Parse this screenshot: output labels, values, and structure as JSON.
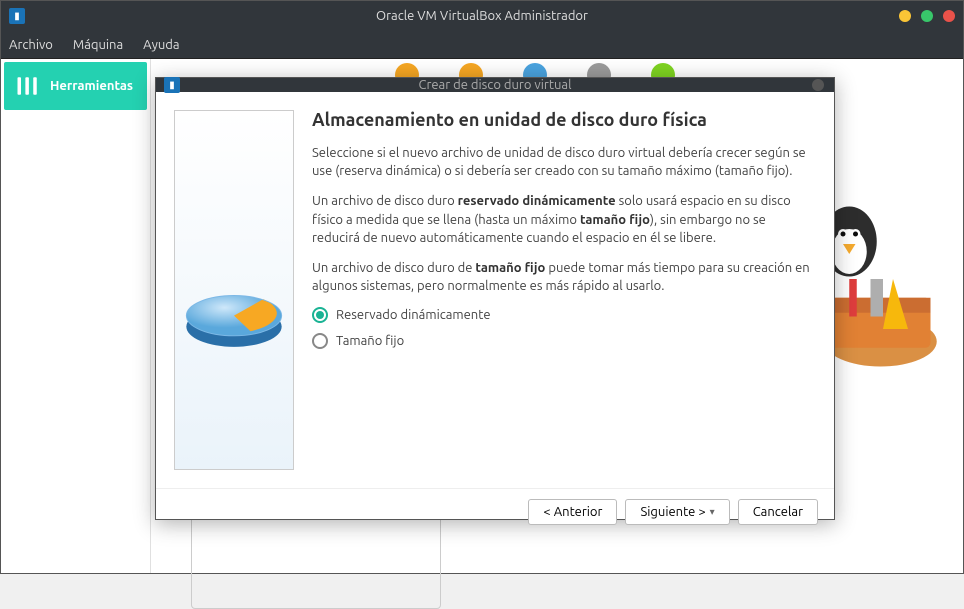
{
  "window": {
    "title": "Oracle VM VirtualBox Administrador"
  },
  "menu": {
    "archivo": "Archivo",
    "maquina": "Máquina",
    "ayuda": "Ayuda"
  },
  "sidebar": {
    "tools": "Herramientas"
  },
  "dialog": {
    "title": "Crear de disco duro virtual",
    "heading": "Almacenamiento en unidad de disco duro física",
    "p1": "Seleccione si el nuevo archivo de unidad de disco duro virtual debería crecer según se use (reserva dinámica) o si debería ser creado con su tamaño máximo (tamaño fijo).",
    "p2_a": "Un archivo de disco duro ",
    "p2_b1": "reservado dinámicamente",
    "p2_c": " solo usará espacio en su disco físico a medida que se llena (hasta un máximo ",
    "p2_b2": "tamaño fijo",
    "p2_d": "), sin embargo no se reducirá de nuevo automáticamente cuando el espacio en él se libere.",
    "p3_a": "Un archivo de disco duro de ",
    "p3_b": "tamaño fijo",
    "p3_c": " puede tomar más tiempo para su creación en algunos sistemas, pero normalmente es más rápido al usarlo.",
    "opt1": "Reservado dinámicamente",
    "opt2": "Tamaño fijo",
    "buttons": {
      "prev": "< Anterior",
      "next": "Siguiente >",
      "cancel": "Cancelar"
    }
  }
}
